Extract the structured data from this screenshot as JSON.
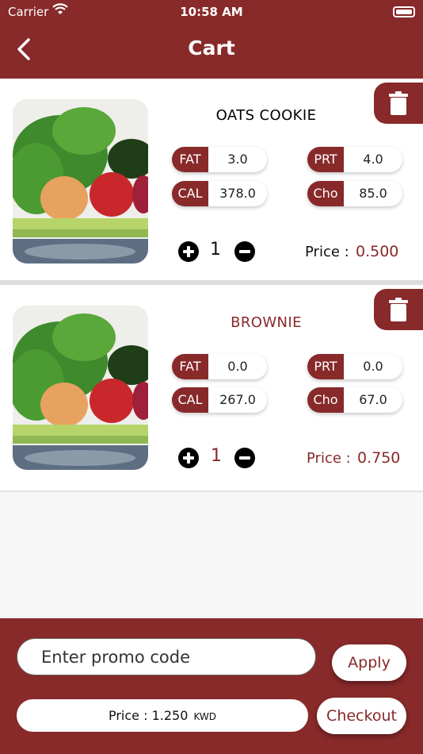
{
  "status_bar": {
    "carrier": "Carrier",
    "time": "10:58 AM"
  },
  "header": {
    "title": "Cart"
  },
  "colors": {
    "brand": "#88292a",
    "background": "#f7f7f7"
  },
  "cart_items": [
    {
      "name": "OATS COOKIE",
      "name_color": "#222222",
      "nutrition": {
        "fat_label": "FAT",
        "fat": "3.0",
        "prt_label": "PRT",
        "prt": "4.0",
        "cal_label": "CAL",
        "cal": "378.0",
        "cho_label": "Cho",
        "cho": "85.0"
      },
      "quantity": "1",
      "price_label": "Price :",
      "price": "0.500"
    },
    {
      "name": "BROWNIE",
      "name_color": "#88292a",
      "nutrition": {
        "fat_label": "FAT",
        "fat": "0.0",
        "prt_label": "PRT",
        "prt": "0.0",
        "cal_label": "CAL",
        "cal": "267.0",
        "cho_label": "Cho",
        "cho": "67.0"
      },
      "quantity": "1",
      "price_label": "Price :",
      "price": "0.750"
    }
  ],
  "footer": {
    "promo_placeholder": "Enter promo code",
    "apply_label": "Apply",
    "total_label": "Price : 1.250",
    "total_unit": "KWD",
    "checkout_label": "Checkout"
  }
}
